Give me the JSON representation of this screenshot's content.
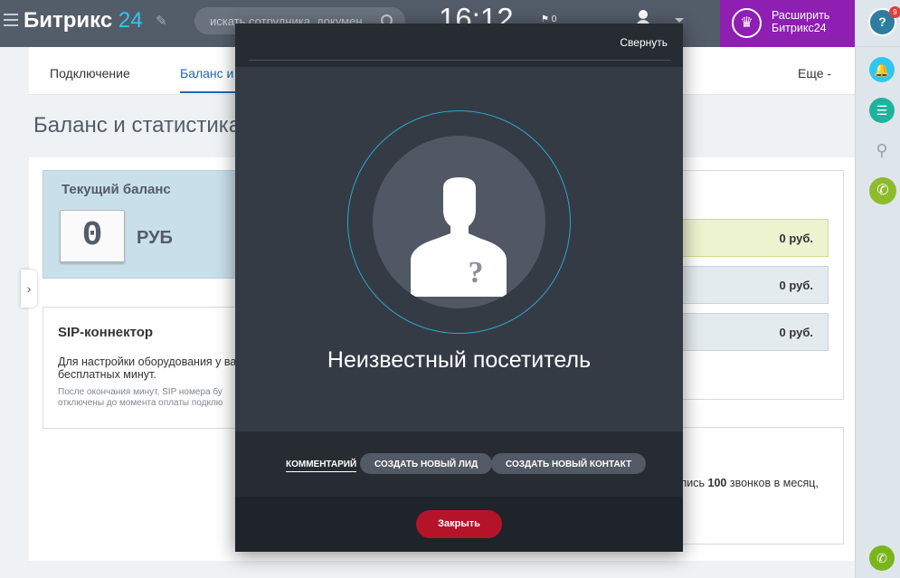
{
  "header": {
    "logo_text": "Битрикс",
    "logo_num": "24",
    "search_placeholder": "искать сотрудника, докумен",
    "clock": "16:12",
    "flag_count": "0",
    "upgrade_line1": "Расширить",
    "upgrade_line2": "Битрикс24"
  },
  "rail": {
    "help_label": "?",
    "help_badge": "9"
  },
  "tabs": {
    "connection": "Подключение",
    "balance": "Баланс и",
    "more": "Еще -"
  },
  "page": {
    "title": "Баланс и статистика",
    "balance_title": "Текущий баланс",
    "balance_digit": "0",
    "currency": "РУБ",
    "sip_title": "SIP-коннектор",
    "sip_text": "Для настройки оборудования у ва бесплатных минут.",
    "sip_note": "После окончания минут, SIP номера бу отключены до момента оплаты подклю",
    "stat_values": [
      "0 руб.",
      "0 руб.",
      "0 руб."
    ],
    "calls_prefix": "лись ",
    "calls_number": "100",
    "calls_suffix": " звонков в месяц,"
  },
  "popup": {
    "collapse_label": "Свернуть",
    "visitor_name": "Неизвестный посетитель",
    "comment_label": "Комментарий",
    "new_lead_label": "Создать новый лид",
    "new_contact_label": "Создать новый контакт",
    "close_label": "Закрыть"
  },
  "colors": {
    "topbar": "#535c69",
    "upgrade": "#8f1eb3",
    "accent_blue": "#2067b0",
    "ring": "#2aa7c9",
    "close_button": "#b5132a",
    "call_green": "#8dbb2c"
  }
}
